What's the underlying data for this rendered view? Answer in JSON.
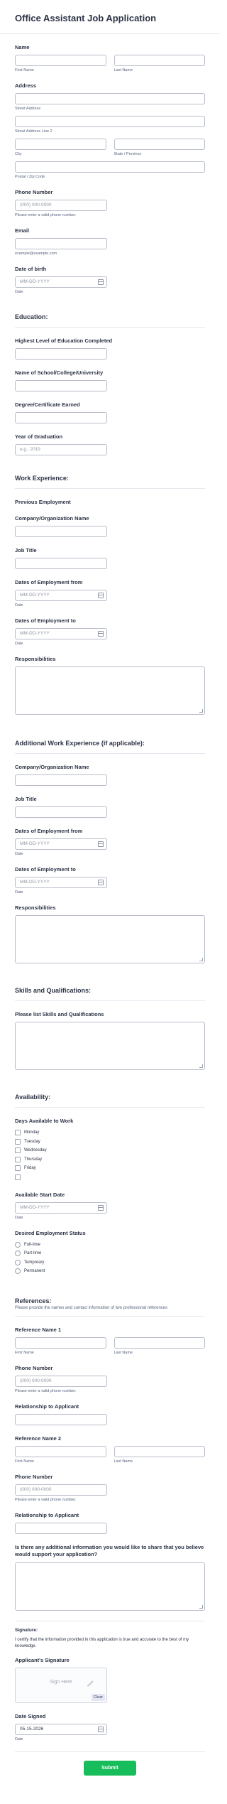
{
  "title": "Office Assistant Job Application",
  "name": {
    "label": "Name",
    "first": "First Name",
    "last": "Last Name"
  },
  "address": {
    "label": "Address",
    "street1": "Street Address",
    "street2": "Street Address Line 2",
    "city": "City",
    "state": "State / Province",
    "zip": "Postal / Zip Code"
  },
  "phone": {
    "label": "Phone Number",
    "placeholder": "(000) 000-0000",
    "help": "Please enter a valid phone number."
  },
  "email": {
    "label": "Email",
    "sub": "example@example.com"
  },
  "dob": {
    "label": "Date of birth",
    "placeholder": "MM-DD-YYYY",
    "sub": "Date"
  },
  "education": {
    "heading": "Education:",
    "highest": "Highest Level of Education Completed",
    "school": "Name of School/College/University",
    "degree": "Degree/Certificate Earned",
    "grad_year": "Year of Graduation",
    "grad_placeholder": "e.g., 2019"
  },
  "work": {
    "heading": "Work Experience:",
    "previous": "Previous Employment",
    "company": "Company/Organization Name",
    "job_title": "Job Title",
    "from": "Dates of Employment from",
    "to": "Dates of Employment to",
    "date_placeholder": "MM-DD-YYYY",
    "date_sub": "Date",
    "responsibilities": "Responsibilities"
  },
  "additional_work": {
    "heading": "Additional Work Experience (if applicable):",
    "company": "Company/Organization Name",
    "job_title": "Job Title",
    "from": "Dates of Employment from",
    "to": "Dates of Employment to",
    "date_placeholder": "MM-DD-YYYY",
    "date_sub": "Date",
    "responsibilities": "Responsibilities"
  },
  "skills": {
    "heading": "Skills and Qualifications:",
    "label": "Please list Skills and Qualifications"
  },
  "availability": {
    "heading": "Availability:",
    "days_label": "Days Available to Work",
    "days": [
      "Monday",
      "Tuesday",
      "Wednesday",
      "Thursday",
      "Friday"
    ],
    "start_label": "Available Start Date",
    "start_placeholder": "MM-DD-YYYY",
    "start_sub": "Date",
    "status_label": "Desired Employment Status",
    "statuses": [
      "Full-time",
      "Part-time",
      "Temporary",
      "Permanent"
    ]
  },
  "references": {
    "heading": "References:",
    "desc": "Please provide the names and contact information of two professional references",
    "ref1": "Reference Name 1",
    "ref2": "Reference Name 2",
    "first": "First Name",
    "last": "Last Name",
    "phone": "Phone Number",
    "phone_placeholder": "(000) 000-0000",
    "phone_help": "Please enter a valid phone number.",
    "relationship": "Relationship to Applicant"
  },
  "additional_info": {
    "label": "Is there any additional information you would like to share that you believe would support your application?"
  },
  "signature": {
    "heading": "Signature:",
    "certify": "I certify that the information provided in this application is true and accurate to the best of my knowledge.",
    "applicant": "Applicant's Signature",
    "sign_here": "Sign Here",
    "clear": "Clear",
    "date_signed": "Date Signed",
    "date_value": "05-15-2026",
    "date_sub": "Date"
  },
  "submit": "Submit"
}
